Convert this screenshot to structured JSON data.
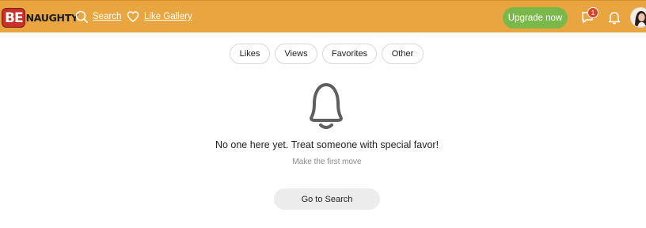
{
  "header": {
    "logo_be": "BE",
    "logo_naughty": "NAUGHTY",
    "nav": {
      "search_label": "Search",
      "gallery_label": "Like Gallery"
    },
    "upgrade_label": "Upgrade now",
    "messages_badge": "1",
    "icons": [
      "search-icon",
      "heart-gallery-icon",
      "chat-icon",
      "bell-icon",
      "avatar"
    ],
    "colors": {
      "bar": "#e9a640",
      "upgrade": "#7bb84a",
      "badge": "#d9452a"
    }
  },
  "tabs": [
    {
      "label": "Likes"
    },
    {
      "label": "Views"
    },
    {
      "label": "Favorites"
    },
    {
      "label": "Other"
    }
  ],
  "empty_state": {
    "icon": "bell-icon",
    "title": "No one here yet. Treat someone with special favor!",
    "subtitle": "Make the first move",
    "button_label": "Go to Search"
  }
}
